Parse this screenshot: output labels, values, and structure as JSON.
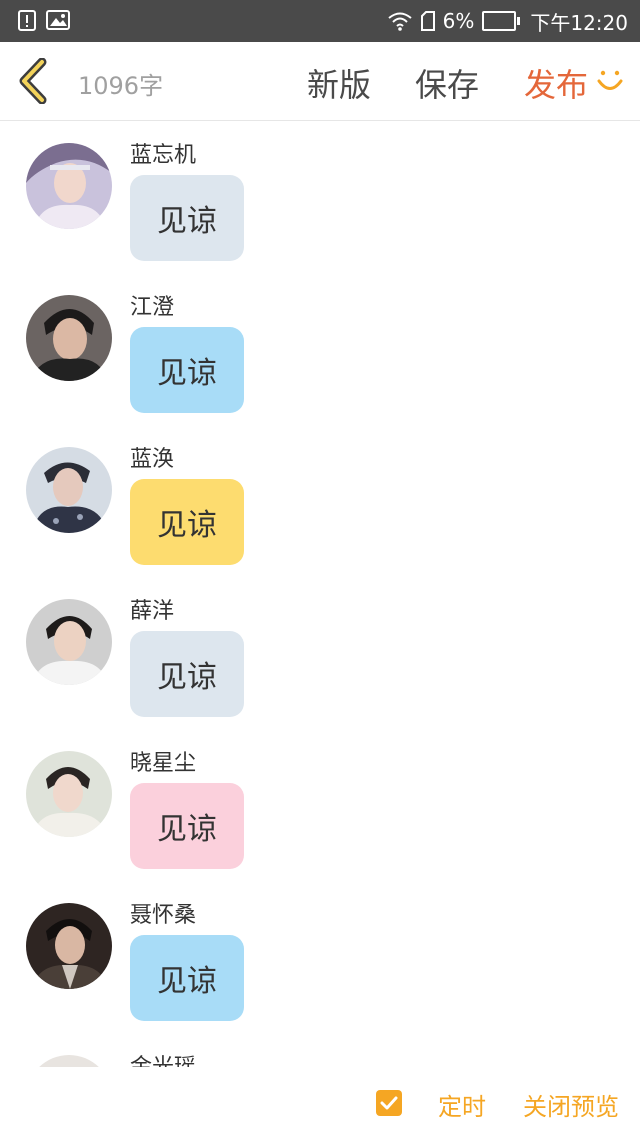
{
  "status_bar": {
    "battery": "6%",
    "time": "下午12:20"
  },
  "header": {
    "word_count": "1096字",
    "new_version": "新版",
    "save": "保存",
    "publish": "发布"
  },
  "chat": [
    {
      "name": "蓝忘机",
      "message": "见谅",
      "bubble_color": "#dde6ee"
    },
    {
      "name": "江澄",
      "message": "见谅",
      "bubble_color": "#a8dcf7"
    },
    {
      "name": "蓝涣",
      "message": "见谅",
      "bubble_color": "#fddc6f"
    },
    {
      "name": "薛洋",
      "message": "见谅",
      "bubble_color": "#dde6ee"
    },
    {
      "name": "晓星尘",
      "message": "见谅",
      "bubble_color": "#fbd0dc"
    },
    {
      "name": "聂怀桑",
      "message": "见谅",
      "bubble_color": "#a8dcf7"
    },
    {
      "name": "金光瑶",
      "message": "",
      "bubble_color": "#dde6ee"
    }
  ],
  "bottom_bar": {
    "timer": "定时",
    "close_preview": "关闭预览"
  },
  "colors": {
    "accent": "#f5a623",
    "publish": "#e4673a",
    "status_bar": "#4a4a4a"
  }
}
